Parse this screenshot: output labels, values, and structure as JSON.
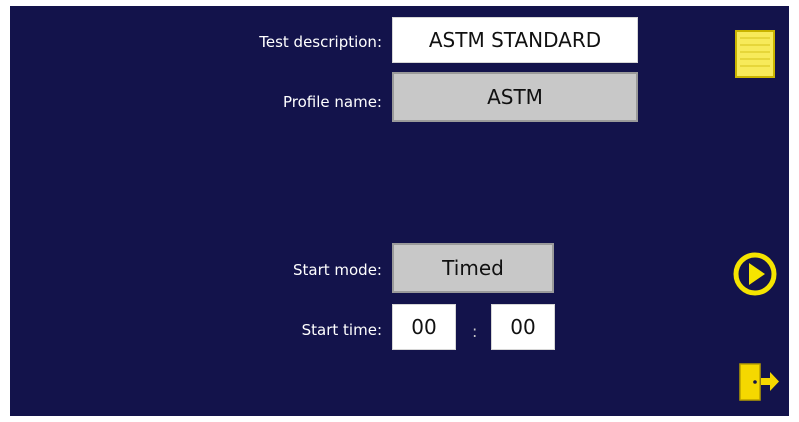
{
  "test_description": {
    "label": "Test description:",
    "value": "ASTM STANDARD"
  },
  "profile_name": {
    "label": "Profile name:",
    "value": "ASTM"
  },
  "start_mode": {
    "label": "Start mode:",
    "value": "Timed"
  },
  "start_time": {
    "label": "Start time:",
    "hours": "00",
    "separator": ":",
    "minutes": "00"
  },
  "icons": [
    "notes-icon",
    "play-icon",
    "exit-door-icon"
  ],
  "colors": {
    "background": "#13134b",
    "icon_yellow": "#f5e400",
    "field_gray": "#c8c8c8"
  }
}
